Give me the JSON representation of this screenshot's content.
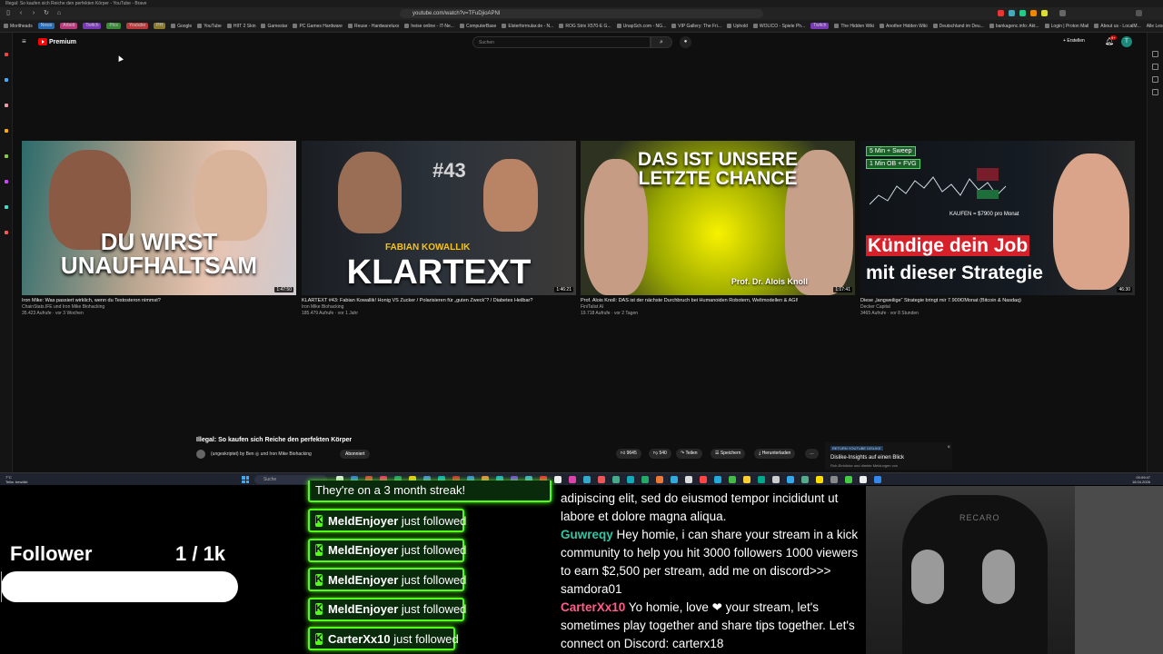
{
  "browser": {
    "tab_title": "Illegal: So kaufen sich Reiche den perfekten Körper - YouTube - Brave",
    "url": "youtube.com/watch?v=TFuDjioAPNI",
    "bookmarks": [
      "Moritheads",
      "News",
      "Arbeit",
      "Twitch",
      "Pics",
      "Youtube",
      "PH",
      "Google",
      "YouTube",
      "HIIT 2 Skin",
      "Gamestar",
      "PC Games Hardware",
      "Reuse - Hardwareluxx",
      "heise online - IT-Ne...",
      "ComputerBase",
      "Elsterformular.de - N...",
      "ROG Strix X570-E G...",
      "UnapSch.com - NG...",
      "VIP Gallery: The Fri...",
      "Uphold",
      "WOLICO - Spiele Ph...",
      "Twitch",
      "The Hidden Wiki",
      "Another Hidden Wiki",
      "Deutschland im Deu...",
      "bankagenc.info: Akt...",
      "Login | Proton Mail",
      "About us - LocalM..."
    ],
    "bookmarks_more": "Alle Lesezeichen"
  },
  "youtube": {
    "logo_text": "Premium",
    "search_placeholder": "Suchen",
    "create_label": "Erstellen",
    "notifications": "9+",
    "avatar_letter": "T",
    "videos": [
      {
        "big_text": "DU WIRST UNAUFHALTSAM",
        "duration": "1:47:50",
        "title": "Iron Mike: Was passiert wirklich, wenn du Testosteron nimmst?",
        "channel": "ChainStats.IFE und Iron Mike Biohacking",
        "meta": "35.423 Aufrufe · vor 3 Wochen"
      },
      {
        "overlay_top": "#43",
        "overlay_mid": "FABIAN KOWALLIK",
        "big_text": "KLARTEXT",
        "duration": "1:46:21",
        "title": "KLARTEXT #43: Fabian Kowallik! Honig VS Zucker / Polarisieren für „guten Zweck“? / Diabetes Heilbar?",
        "channel": "Iron Mike Biohacking",
        "meta": "185.479 Aufrufe · vor 1 Jahr"
      },
      {
        "big_text": "DAS IST UNSERE LETZTE CHANCE",
        "caption": "Prof. Dr. Alois Knoll",
        "duration": "1:17:41",
        "title": "Prof. Alois Knoll: DAS ist der nächste Durchbruch bei Humanoiden Robotern, Weltmodellen & AGI!",
        "channel": "FiniTalist AI",
        "meta": "19.718 Aufrufe · vor 2 Tagen"
      },
      {
        "badge1": "5 Min + Sweep",
        "badge2": "1 Min OB + FVG",
        "kaufen": "KAUFEN = $7900 pro Monat",
        "big_line1": "Kündige dein Job",
        "big_line2": "mit dieser Strategie",
        "duration": "46:30",
        "title": "Diese „langweilige“ Strategie bringt mir 7.900€/Monat (Bitcoin & Nasdaq)",
        "channel": "Decker Capital",
        "meta": "3465 Aufrufe · vor 8 Stunden"
      }
    ],
    "now_playing": {
      "title": "Illegal: So kaufen sich Reiche den perfekten Körper",
      "channel": "(ungeskriptet) by Ben ◎ und Iron Mike Biohacking",
      "subscribe": "Abonniert",
      "likes": "9645",
      "dislikes": "540",
      "share": "Teilen",
      "save": "Speichern",
      "download": "Herunterladen",
      "more": "…"
    },
    "promo": {
      "tag": "RETURN YOUTUBE DISLIKE",
      "title": "Dislike-Insights auf einen Blick",
      "subtitle": "Roh-Einblicke und direkte Meldungen von",
      "close": "×"
    }
  },
  "taskbar": {
    "weather_temp": "7°C",
    "weather_text": "Teilw. bewölkt",
    "search_placeholder": "Suche",
    "time": "00:09:47",
    "date": "18.04.2026"
  },
  "overlay": {
    "follower_label": "Follower",
    "follower_count": "1 / 1k",
    "follower_progress": 0.001,
    "streak_text": "They're on a 3 month streak!",
    "alerts": [
      {
        "user": "MeldEnjoyer",
        "text": " just followed"
      },
      {
        "user": "MeldEnjoyer",
        "text": " just followed"
      },
      {
        "user": "MeldEnjoyer",
        "text": " just followed"
      },
      {
        "user": "MeldEnjoyer",
        "text": " just followed"
      },
      {
        "user": "CarterXx10",
        "text": " just followed"
      }
    ],
    "chat": [
      {
        "user": "",
        "color": "#ffffff",
        "text": "adipiscing elit, sed do eiusmod tempor incididunt ut labore et dolore magna aliqua."
      },
      {
        "user": "Guwreqy",
        "color": "#34c5a4",
        "text": " Hey homie, i can share your stream in a kick community to help you hit 3000 followers 1000 viewers to earn $2,500 per stream, add me on discord>>> samdora01"
      },
      {
        "user": "CarterXx10",
        "color": "#ff5c8a",
        "text": " Yo homie, love ❤ your stream, let's sometimes play together and share tips together. Let's connect on Discord: carterx18"
      }
    ],
    "cam_brand": "RECARO"
  }
}
